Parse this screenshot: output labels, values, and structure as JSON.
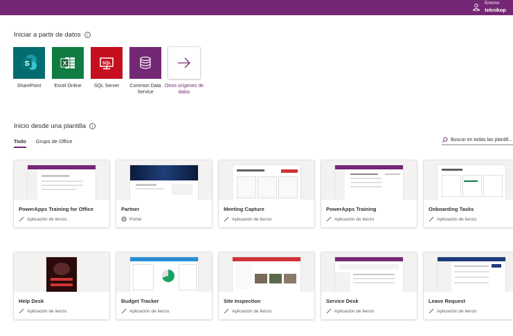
{
  "header": {
    "env_label": "Entorno",
    "env_name": "teknikop"
  },
  "data_section": {
    "title": "Iniciar a partir de datos",
    "sources": [
      {
        "label": "SharePoint",
        "icon": "sharepoint-icon",
        "color": "#036C70"
      },
      {
        "label": "Excel Online",
        "icon": "excel-icon",
        "color": "#107C41"
      },
      {
        "label": "SQL Server",
        "icon": "sql-server-icon",
        "color": "#C50F1F"
      },
      {
        "label": "Common Data Service",
        "icon": "common-data-service-icon",
        "color": "#742774"
      },
      {
        "label": "Otros orígenes de datos",
        "icon": "arrow-right-icon",
        "color": "#742774"
      }
    ]
  },
  "template_section": {
    "title": "Inicio desde una plantilla",
    "tabs": [
      "Todo",
      "Grupo de Office"
    ],
    "search_placeholder": "Buscar en todas las plantill..."
  },
  "templates": [
    {
      "title": "PowerApps Training for Office",
      "type": "Aplicación de lienzo"
    },
    {
      "title": "Partner",
      "type": "Portal"
    },
    {
      "title": "Meeting Capture",
      "type": "Aplicación de lienzo"
    },
    {
      "title": "PowerApps Training",
      "type": "Aplicación de lienzo"
    },
    {
      "title": "Onboarding Tasks",
      "type": "Aplicación de lienzo"
    },
    {
      "title": "Help Desk",
      "type": "Aplicación de lienzo"
    },
    {
      "title": "Budget Tracker",
      "type": "Aplicación de lienzo"
    },
    {
      "title": "Site Inspection",
      "type": "Aplicación de lienzo"
    },
    {
      "title": "Service Desk",
      "type": "Aplicación de lienzo"
    },
    {
      "title": "Leave Request",
      "type": "Aplicación de lienzo"
    }
  ],
  "colors": {
    "brand": "#742774",
    "text": "#323130",
    "secondary": "#605e5c"
  }
}
